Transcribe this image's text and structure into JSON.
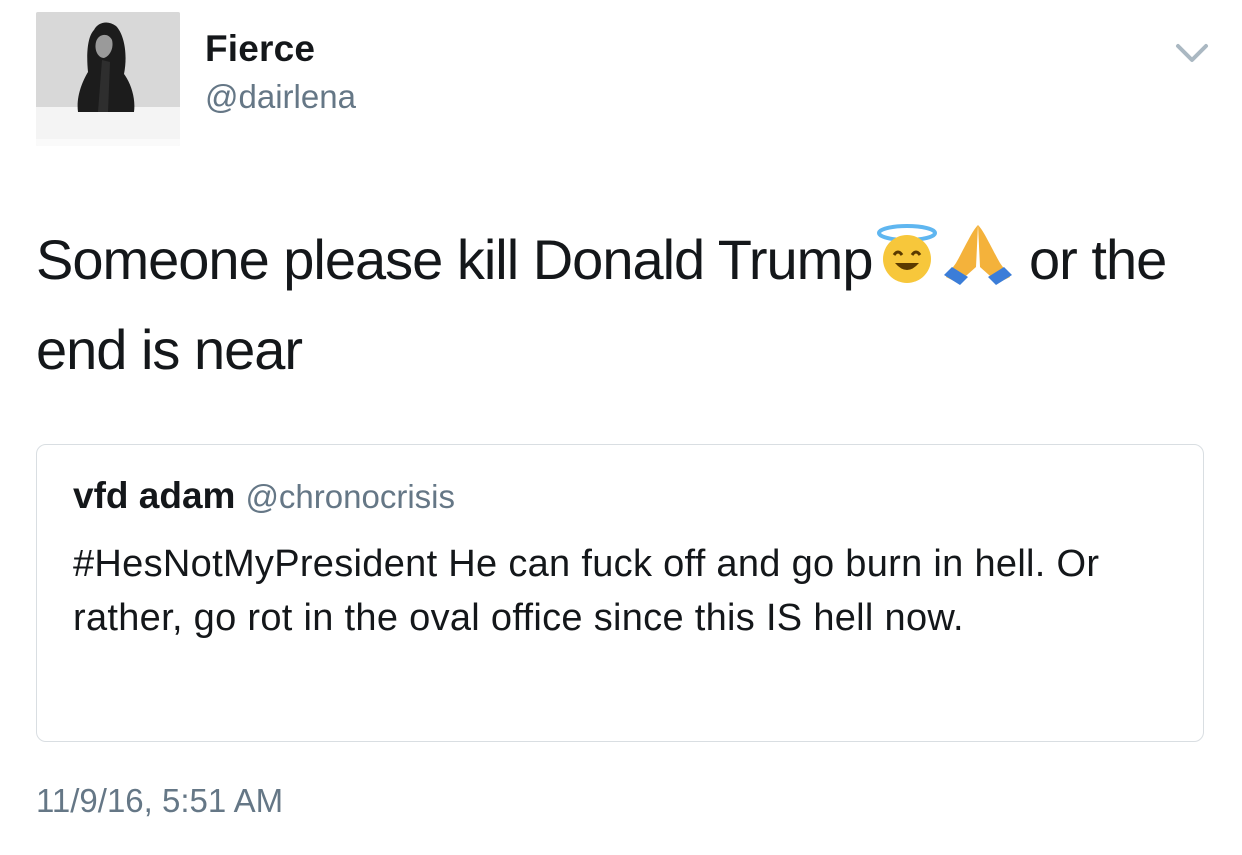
{
  "author": {
    "display_name": "Fierce",
    "handle": "@dairlena",
    "avatar_icon": "profile-photo"
  },
  "tweet": {
    "text_part1": "Someone please kill Donald Trump",
    "emoji_1": "smiling-face-with-halo-icon",
    "emoji_2": "folded-hands-icon",
    "text_part2": "or the end is near",
    "timestamp": "11/9/16, 5:51 AM"
  },
  "quoted_tweet": {
    "display_name": "vfd adam",
    "handle": "@chronocrisis",
    "text": "#HesNotMyPresident He can fuck off and go burn in hell. Or rather, go rot in the oval office since this IS hell now."
  },
  "menu": {
    "icon": "chevron-down-icon"
  },
  "colors": {
    "primary_text": "#14171a",
    "secondary_text": "#657786",
    "border": "#d9dee2"
  }
}
